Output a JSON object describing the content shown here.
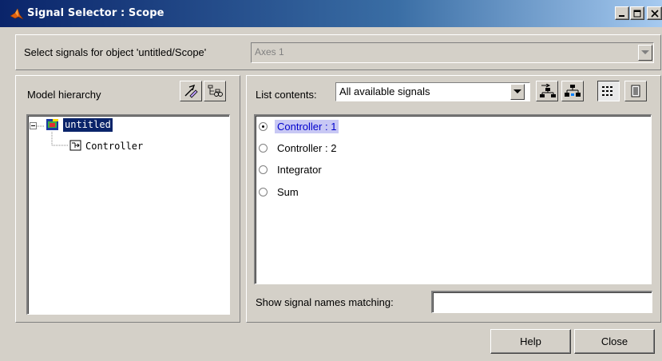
{
  "window": {
    "title": "Signal Selector : Scope"
  },
  "selector": {
    "label": "Select signals for object 'untitled/Scope'",
    "axes_value": "Axes 1"
  },
  "model_hierarchy": {
    "label": "Model hierarchy",
    "root": "untitled",
    "child": "Controller"
  },
  "list": {
    "label": "List contents:",
    "selected_option": "All available signals",
    "signals": [
      {
        "label": "Controller : 1",
        "checked": true
      },
      {
        "label": "Controller : 2",
        "checked": false
      },
      {
        "label": "Integrator",
        "checked": false
      },
      {
        "label": "Sum",
        "checked": false
      }
    ]
  },
  "filter": {
    "label": "Show signal names matching:",
    "value": ""
  },
  "buttons": {
    "help": "Help",
    "close": "Close"
  },
  "colors": {
    "title_bar_start": "#0a246a",
    "title_bar_end": "#a6caf0",
    "selected_highlight": "#c8c8f4",
    "selected_text": "#0000cc",
    "tree_selected": "#0a246a"
  }
}
